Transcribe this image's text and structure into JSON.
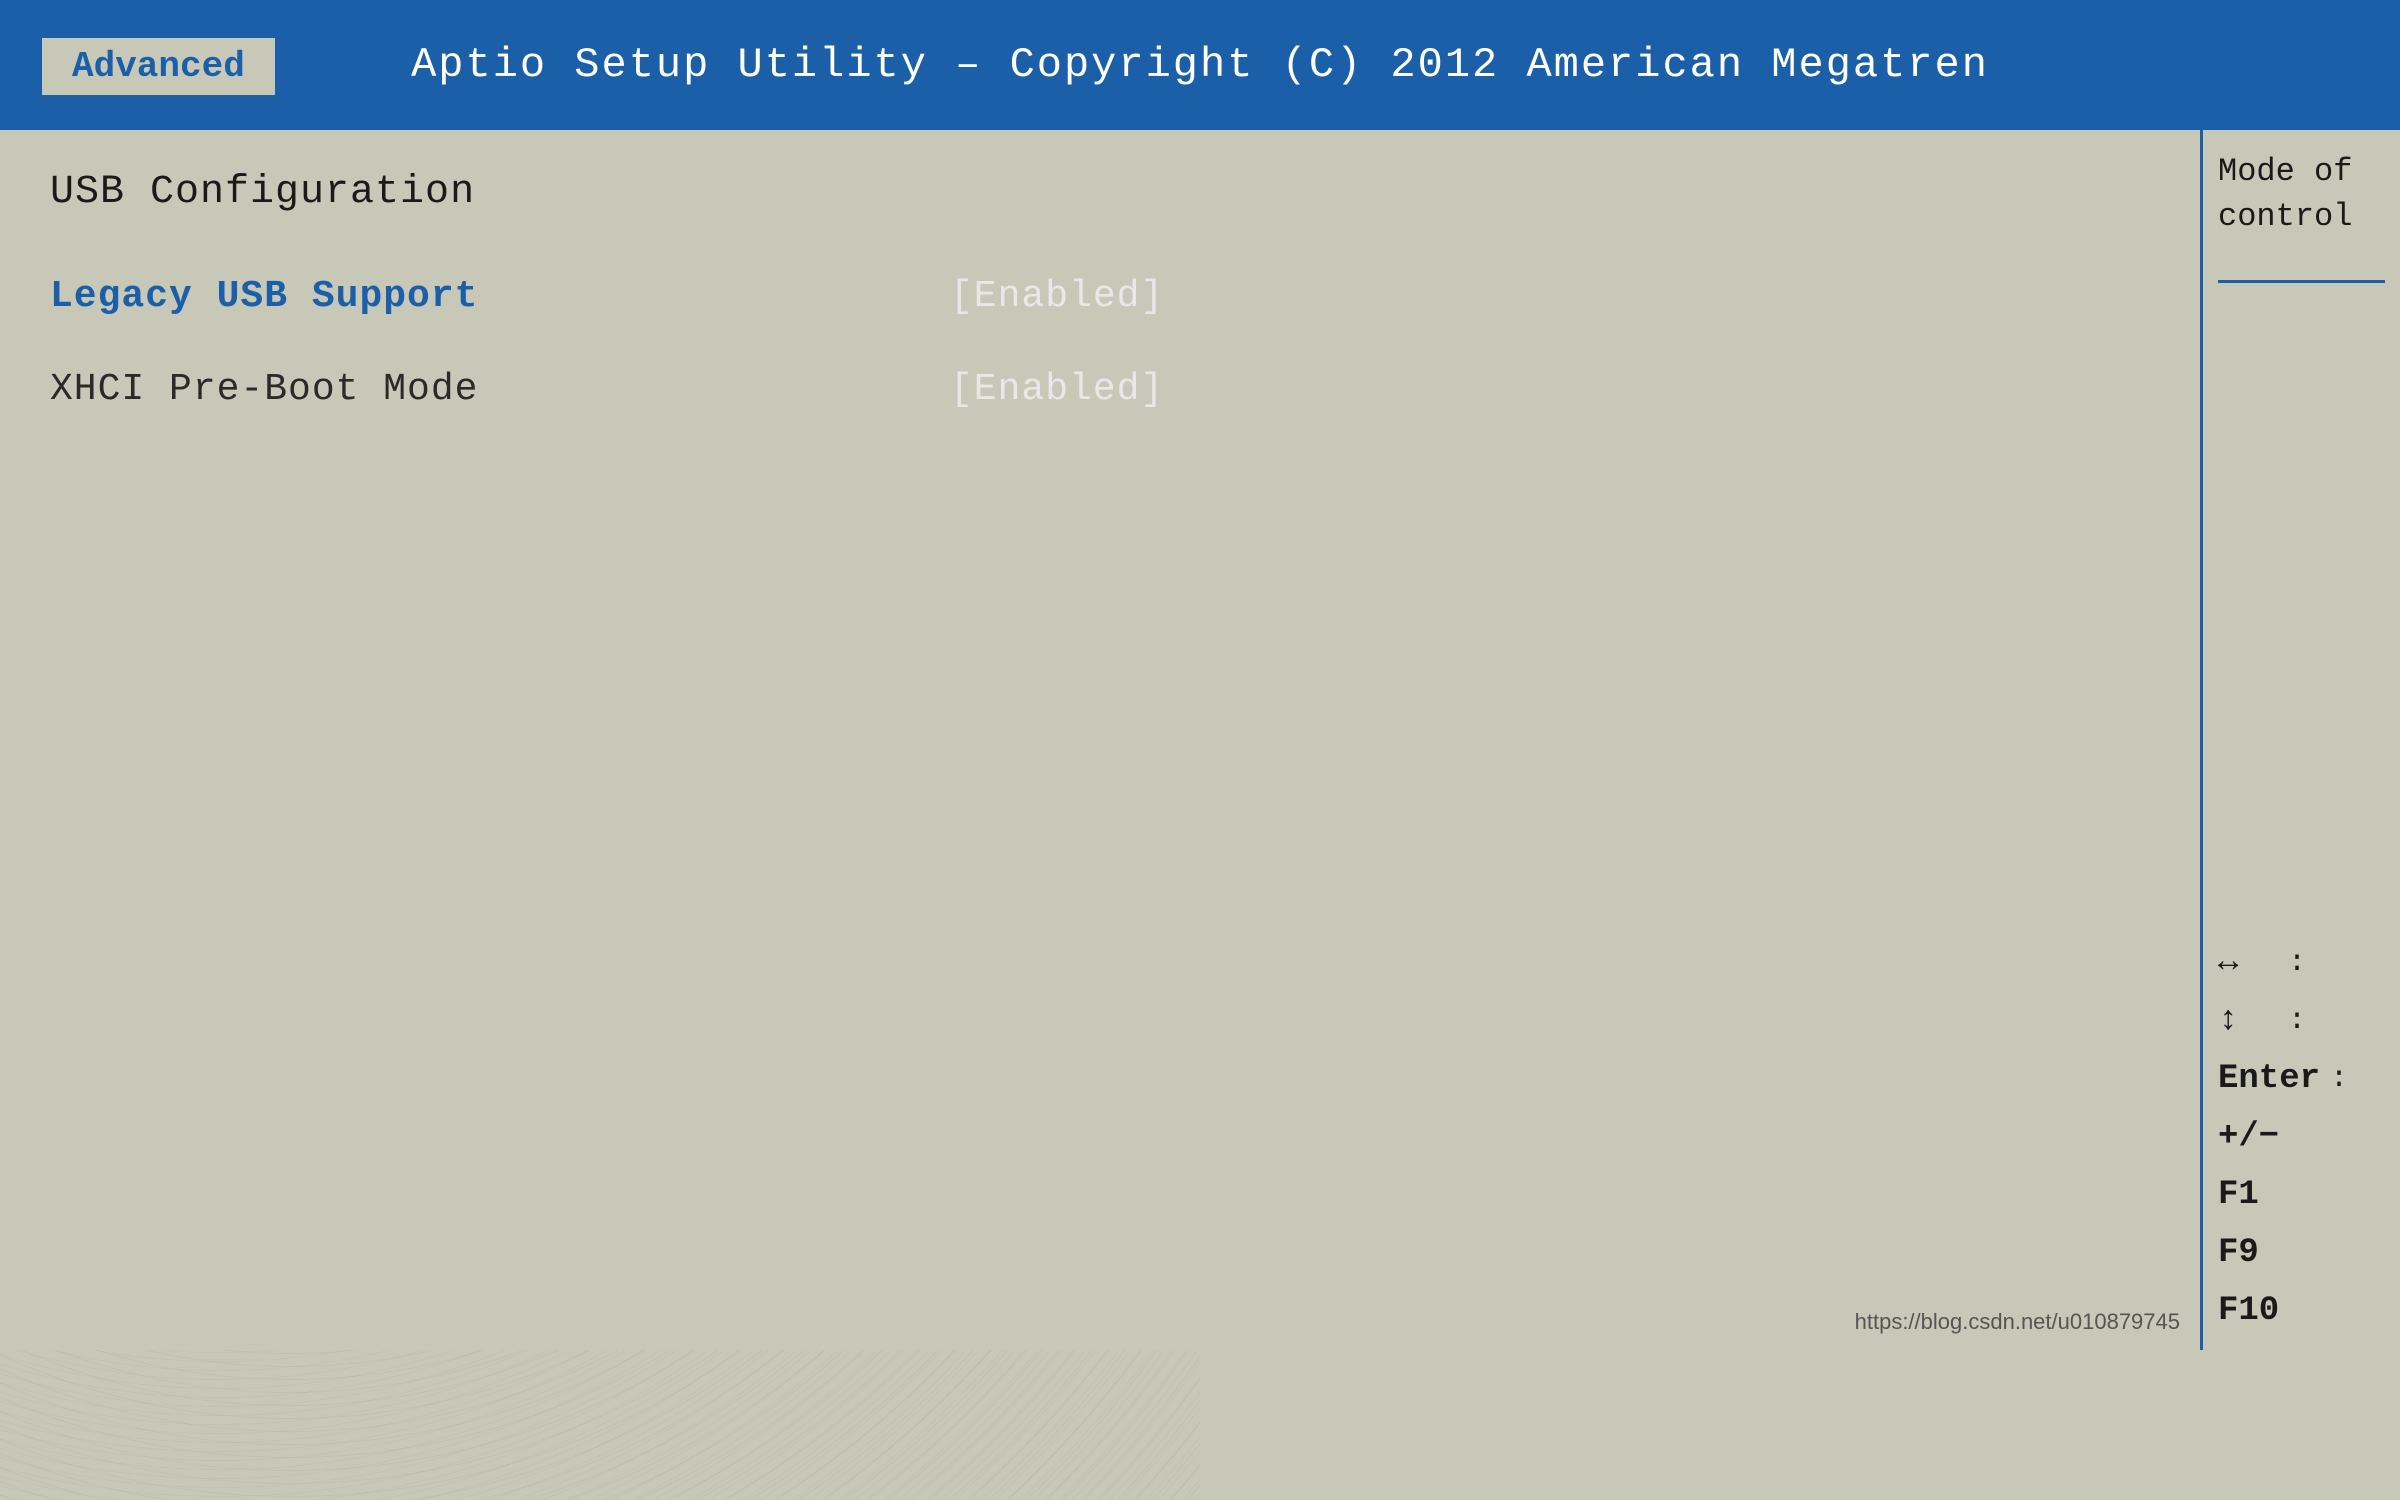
{
  "header": {
    "title": "Aptio Setup Utility – Copyright (C) 2012 American Megatren",
    "tab_label": "Advanced"
  },
  "main": {
    "section_title": "USB Configuration",
    "config_items": [
      {
        "label": "Legacy USB Support",
        "value": "[Enabled]",
        "active": true
      },
      {
        "label": "XHCI Pre-Boot Mode",
        "value": "[Enabled]",
        "active": false
      }
    ]
  },
  "sidebar": {
    "help_line1": "Mode of",
    "help_line2": "control",
    "keys": [
      {
        "symbol": "↔",
        "desc": ":"
      },
      {
        "symbol": "↕",
        "desc": ":"
      },
      {
        "symbol": "Enter",
        "desc": ":"
      },
      {
        "symbol": "+/−",
        "desc": ""
      },
      {
        "symbol": "F1",
        "desc": ""
      },
      {
        "symbol": "F9",
        "desc": ""
      },
      {
        "symbol": "F10",
        "desc": ""
      }
    ]
  },
  "watermark": "https://blog.csdn.net/u010879745"
}
